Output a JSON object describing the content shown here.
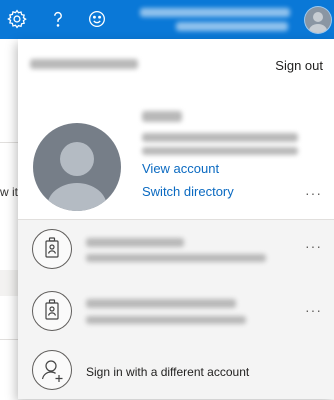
{
  "topbar": {
    "icons": [
      "gear-icon",
      "help-icon",
      "smiley-icon"
    ],
    "accent_color": "#0a78d7"
  },
  "background": {
    "snippet": "w it'"
  },
  "panel": {
    "sign_out_label": "Sign out",
    "view_account_label": "View account",
    "switch_directory_label": "Switch directory",
    "more_label": "···",
    "other_accounts": [
      {
        "icon": "badge-icon",
        "more_label": "···"
      },
      {
        "icon": "badge-icon",
        "more_label": "···"
      }
    ],
    "sign_in_different": {
      "icon": "add-person-icon",
      "label": "Sign in with a different account"
    }
  }
}
